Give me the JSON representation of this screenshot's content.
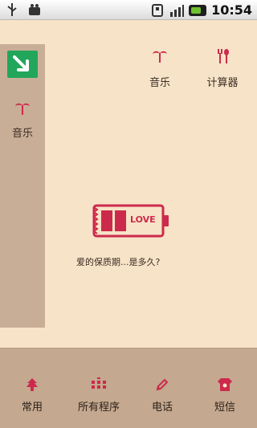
{
  "status_bar": {
    "time": "10:54",
    "icons": [
      "usb-icon",
      "android-debug-icon",
      "sim-icon",
      "signal-icon",
      "battery-icon"
    ]
  },
  "left_panel": {
    "shortcut": {
      "icon": "diagonal-arrow-icon",
      "color": "#21a65b"
    },
    "apps": [
      {
        "label": "音乐",
        "icon": "palm-icon"
      }
    ]
  },
  "top_apps": [
    {
      "label": "音乐",
      "icon": "palm-icon"
    },
    {
      "label": "计算器",
      "icon": "fork-spoon-icon"
    }
  ],
  "widget": {
    "battery_text": "LOVE",
    "caption": "爱的保质期...是多久?"
  },
  "dock": {
    "items": [
      {
        "label": "常用",
        "icon": "pine-icon"
      },
      {
        "label": "所有程序",
        "icon": "grid-icon"
      },
      {
        "label": "电话",
        "icon": "pencil-icon"
      },
      {
        "label": "短信",
        "icon": "tshirt-icon"
      }
    ]
  },
  "colors": {
    "background": "#f7e3c7",
    "panel": "#c9ae97",
    "accent": "#cc2a4c",
    "text": "#3b2d25"
  }
}
